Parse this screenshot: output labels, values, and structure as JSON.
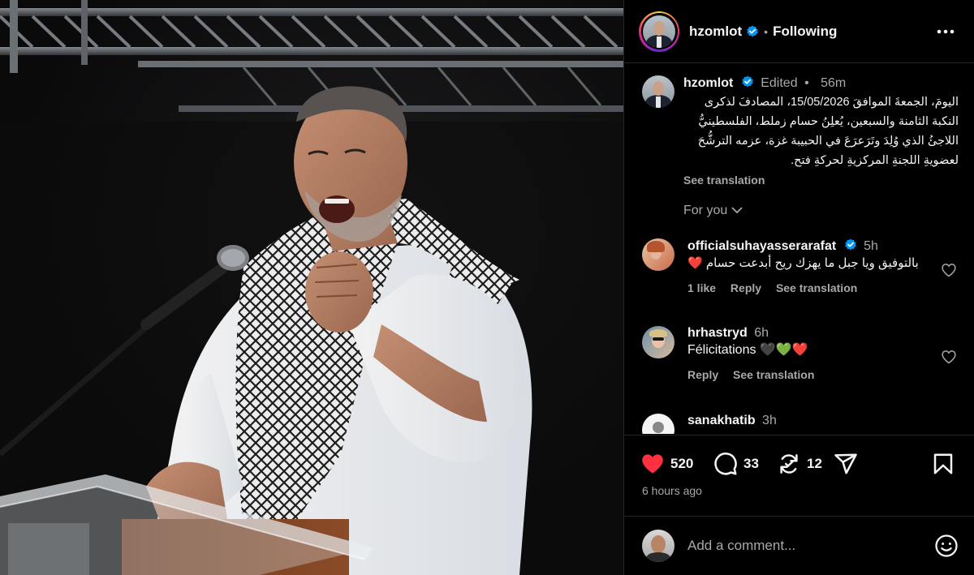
{
  "post": {
    "author": "hzomlot",
    "follow_state": "Following",
    "separator": "•"
  },
  "caption": {
    "username": "hzomlot",
    "edited": "Edited",
    "separator": "•",
    "time": "56m",
    "text": "اليومَ، الجمعةَ الموافقَ 15/05/2026، المصادفَ لذكرى النكبة الثامنة والسبعين، يُعلِنُ حسام زملط، الفلسطينيُّ اللاجئُ الذي وُلِدَ وتَرَعرَعَ في الحبيبة غزة، عزمه الترشُّحَ لعضويةِ اللجنةِ المركزيةِ لحركةِ فتح.",
    "see_translation": "See translation"
  },
  "for_you": "For you",
  "comments": [
    {
      "username": "officialsuhayasserarafat",
      "verified": true,
      "time": "5h",
      "text": "بالتوفيق ويا جبل ما يهزك ريح أبدعت حسام ❤️",
      "likes": "1 like",
      "reply": "Reply",
      "see_translation": "See translation"
    },
    {
      "username": "hrhastryd",
      "verified": false,
      "time": "6h",
      "text": "Félicitations 🖤💚❤️",
      "reply": "Reply",
      "see_translation": "See translation"
    },
    {
      "username": "sanakhatib",
      "verified": false,
      "time": "3h"
    }
  ],
  "actions": {
    "likes": "520",
    "comments": "33",
    "reposts": "12",
    "posted": "6 hours ago"
  },
  "add_comment": {
    "placeholder": "Add a comment..."
  },
  "icons": {
    "verified": "verified-badge-icon",
    "more": "more-horizontal-icon",
    "like": "heart-filled-icon",
    "comment": "comment-bubble-icon",
    "repost": "repost-icon",
    "share": "send-icon",
    "save": "bookmark-icon",
    "emoji": "smiley-icon"
  },
  "colors": {
    "like_red": "#ff3040",
    "verified_blue": "#0095f6",
    "muted_text": "#a8a8a8"
  }
}
